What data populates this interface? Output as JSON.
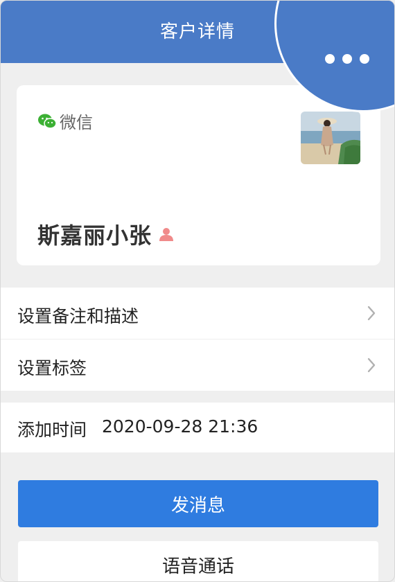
{
  "header": {
    "title": "客户详情"
  },
  "contact": {
    "source_label": "微信",
    "name": "斯嘉丽小张"
  },
  "menu": {
    "items": [
      {
        "label": "设置备注和描述"
      },
      {
        "label": "设置标签"
      }
    ]
  },
  "added": {
    "label": "添加时间",
    "value": "2020-09-28 21:36"
  },
  "actions": {
    "send_message": "发消息",
    "voice_call": "语音通话"
  },
  "colors": {
    "header_bg": "#4a7bc7",
    "primary_button": "#2f7ce0",
    "wechat_green": "#3cb034",
    "gender_icon": "#f08a8a"
  },
  "icons": {
    "more": "more-dots-icon",
    "wechat": "wechat-icon",
    "gender": "person-icon",
    "chevron": "chevron-right-icon"
  }
}
